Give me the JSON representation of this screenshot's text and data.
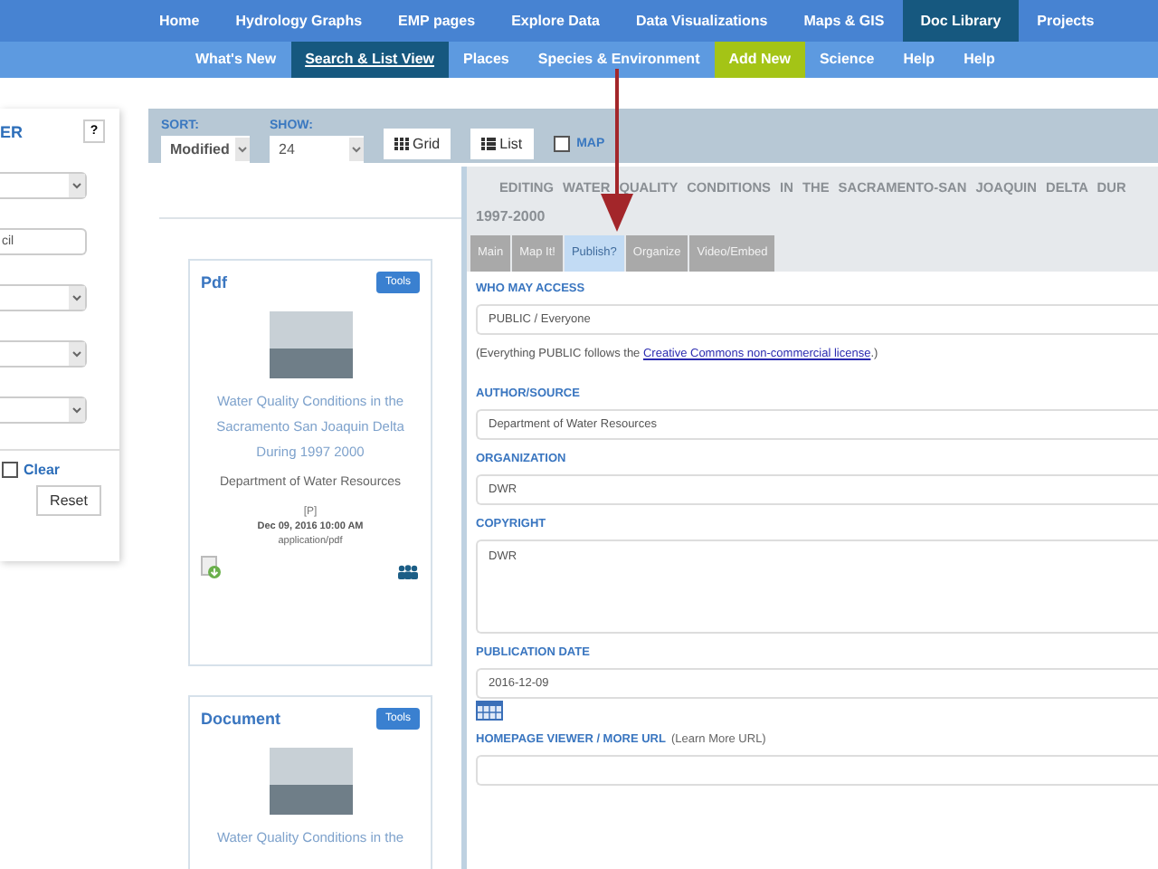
{
  "top_nav": [
    {
      "label": "Home",
      "selected": false
    },
    {
      "label": "Hydrology Graphs",
      "selected": false
    },
    {
      "label": "EMP pages",
      "selected": false
    },
    {
      "label": "Explore Data",
      "selected": false
    },
    {
      "label": "Data Visualizations",
      "selected": false
    },
    {
      "label": "Maps & GIS",
      "selected": false
    },
    {
      "label": "Doc Library",
      "selected": true
    },
    {
      "label": "Projects",
      "selected": false
    }
  ],
  "sub_nav": [
    {
      "label": "What's New",
      "selected": false,
      "kind": "link"
    },
    {
      "label": "Search & List View",
      "selected": true,
      "kind": "link"
    },
    {
      "label": "Places",
      "selected": false,
      "kind": "link"
    },
    {
      "label": "Species & Environment",
      "selected": false,
      "kind": "link"
    },
    {
      "label": "Add New",
      "selected": false,
      "kind": "accent"
    },
    {
      "label": "Science",
      "selected": false,
      "kind": "link"
    },
    {
      "label": "Help",
      "selected": false,
      "kind": "link"
    },
    {
      "label": "Help",
      "selected": false,
      "kind": "link"
    }
  ],
  "filter_panel": {
    "title": "ER",
    "help": "?",
    "fields": [
      {
        "kind": "select"
      },
      {
        "kind": "input",
        "value": "cil"
      },
      {
        "kind": "select"
      },
      {
        "kind": "select"
      },
      {
        "kind": "select"
      }
    ],
    "clear": {
      "label": "Clear",
      "checked": false
    },
    "reset": "Reset"
  },
  "toolbar": {
    "sort": {
      "label": "SORT:",
      "value": "Modified"
    },
    "show": {
      "label": "SHOW:",
      "value": "24"
    },
    "views": [
      {
        "label": "Grid",
        "kind": "grid"
      },
      {
        "label": "List",
        "kind": "list"
      }
    ],
    "map": {
      "label": "MAP",
      "checked": false
    }
  },
  "cards": [
    {
      "type": "Pdf",
      "tools": "Tools",
      "title": "Water Quality Conditions in the Sacramento San Joaquin Delta During 1997 2000",
      "author": "Department of Water Resources",
      "code": "[P]",
      "date": "Dec 09, 2016 10:00 AM",
      "mime": "application/pdf"
    },
    {
      "type": "Document",
      "tools": "Tools",
      "title": "Water Quality Conditions in the"
    }
  ],
  "editor": {
    "title": "EDITING WATER QUALITY CONDITIONS IN THE SACRAMENTO-SAN JOAQUIN DELTA DUR",
    "title_2": "1997-2000",
    "tabs": [
      {
        "label": "Main",
        "selected": false
      },
      {
        "label": "Map It!",
        "selected": false
      },
      {
        "label": "Publish?",
        "selected": true
      },
      {
        "label": "Organize",
        "selected": false
      },
      {
        "label": "Video/Embed",
        "selected": false
      }
    ],
    "fields": [
      {
        "kind": "select",
        "label": "WHO MAY ACCESS",
        "value": "PUBLIC / Everyone"
      },
      {
        "kind": "note",
        "text": "(Everything PUBLIC follows the ",
        "link": "Creative Commons non-commercial license",
        "after": ".)"
      },
      {
        "kind": "input",
        "label": "AUTHOR/SOURCE",
        "value": "Department of Water Resources"
      },
      {
        "kind": "input",
        "label": "ORGANIZATION",
        "value": "DWR"
      },
      {
        "kind": "textarea",
        "label": "COPYRIGHT",
        "value": "DWR"
      },
      {
        "kind": "date",
        "label": "PUBLICATION DATE",
        "value": "2016-12-09"
      },
      {
        "kind": "input",
        "label": "HOMEPAGE VIEWER / MORE URL",
        "hint": "(Learn More URL)"
      }
    ]
  }
}
